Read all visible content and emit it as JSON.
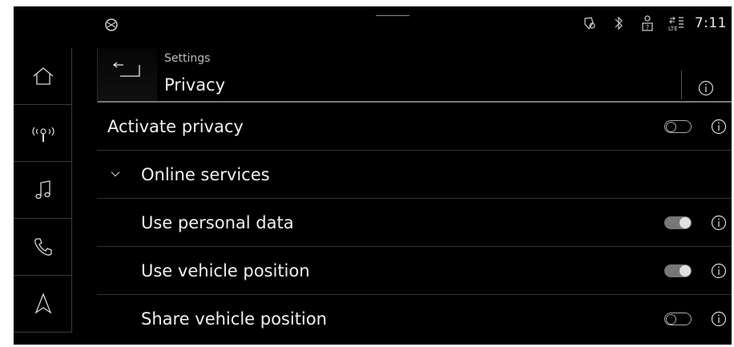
{
  "status_bar": {
    "time": "7:11",
    "icons": [
      "car-logo-icon",
      "location-shield-icon",
      "bluetooth-icon",
      "user-unknown-icon",
      "lte-signal-icon"
    ]
  },
  "nav_rail": [
    {
      "name": "home",
      "icon": "home-icon"
    },
    {
      "name": "radio",
      "icon": "radio-antenna-icon"
    },
    {
      "name": "media",
      "icon": "music-note-icon"
    },
    {
      "name": "phone",
      "icon": "phone-icon"
    },
    {
      "name": "navigation",
      "icon": "navigation-arrow-icon"
    }
  ],
  "header": {
    "breadcrumb": "Settings",
    "title": "Privacy"
  },
  "rows": [
    {
      "label": "Activate privacy",
      "toggle": "off",
      "indent": false,
      "expandable": false
    },
    {
      "label": "Online services",
      "toggle": null,
      "indent": true,
      "expandable": true
    },
    {
      "label": "Use personal data",
      "toggle": "on",
      "indent": true,
      "expandable": false
    },
    {
      "label": "Use vehicle position",
      "toggle": "on",
      "indent": true,
      "expandable": false
    },
    {
      "label": "Share vehicle position",
      "toggle": "off",
      "indent": true,
      "expandable": false
    }
  ],
  "colors": {
    "background": "#000000",
    "text": "#f0f0f0",
    "toggle_on_track": "#777777",
    "toggle_on_knob": "#e0e0e0",
    "toggle_off_stroke": "#a8a8a8",
    "divider": "#333333"
  }
}
